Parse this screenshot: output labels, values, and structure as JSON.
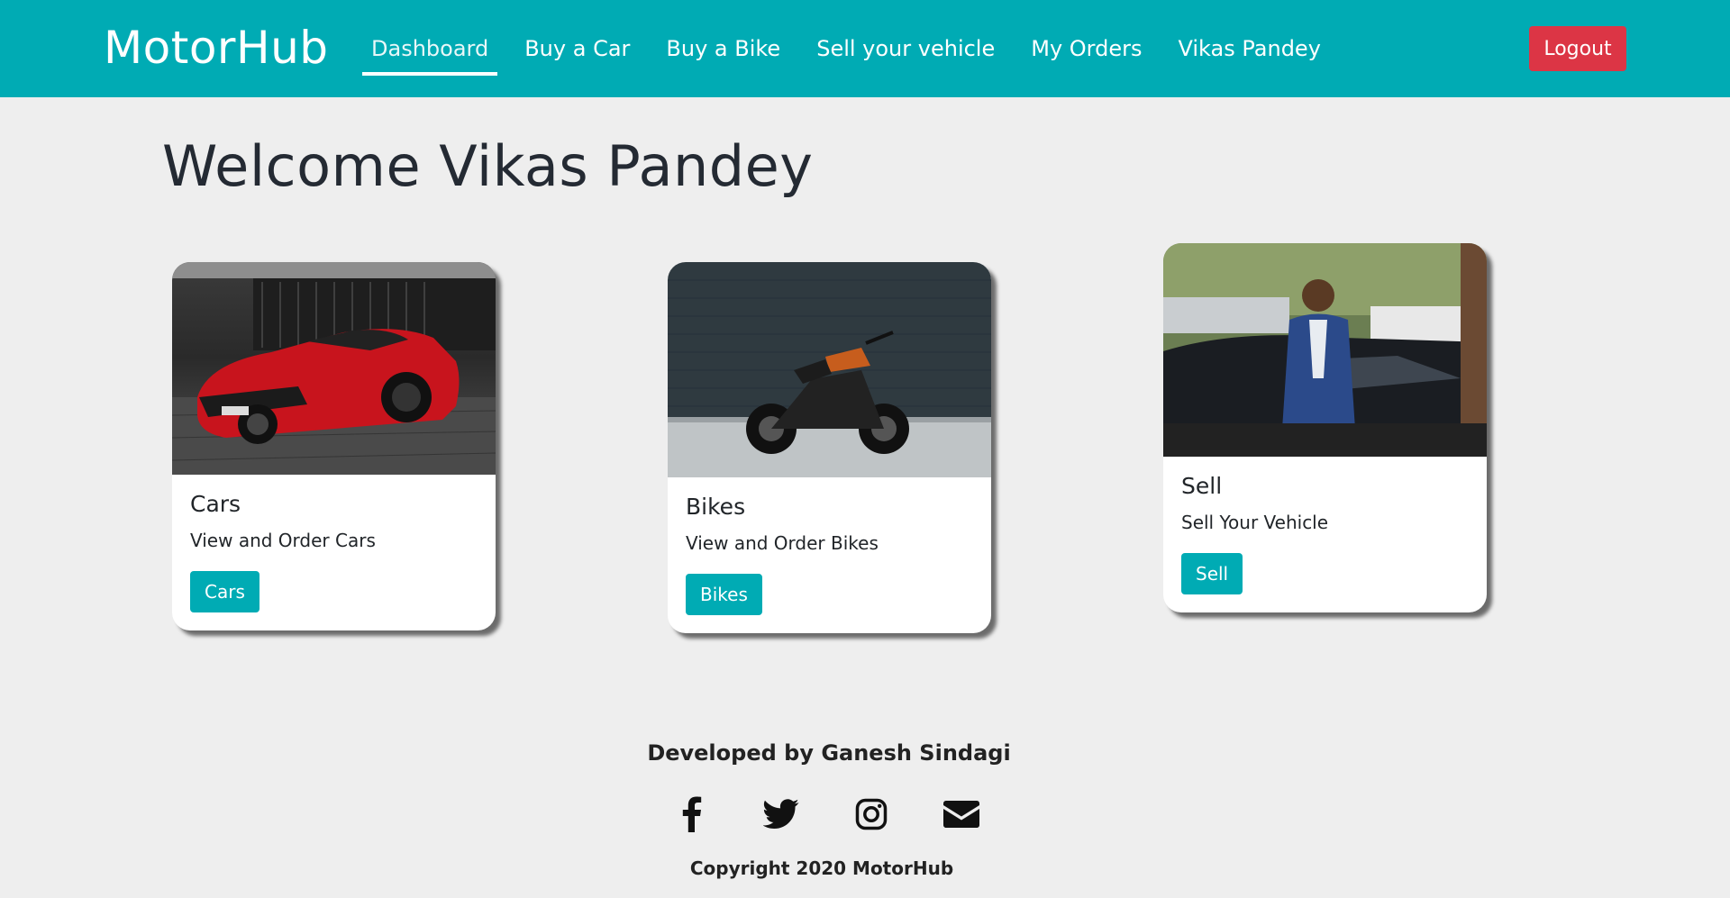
{
  "nav": {
    "brand": "MotorHub",
    "links": [
      {
        "label": "Dashboard",
        "active": true
      },
      {
        "label": "Buy a Car"
      },
      {
        "label": "Buy a Bike"
      },
      {
        "label": "Sell your vehicle"
      },
      {
        "label": "My Orders"
      },
      {
        "label": "Vikas Pandey"
      }
    ],
    "logout_label": "Logout"
  },
  "page": {
    "welcome": "Welcome Vikas Pandey"
  },
  "cards": [
    {
      "title": "Cars",
      "text": "View and Order Cars",
      "button": "Cars",
      "image": "red-sports-car-photo"
    },
    {
      "title": "Bikes",
      "text": "View and Order Bikes",
      "button": "Bikes",
      "image": "motorcycle-photo"
    },
    {
      "title": "Sell",
      "text": "Sell Your Vehicle",
      "button": "Sell",
      "image": "man-beside-car-photo"
    }
  ],
  "footer": {
    "developed_by": "Developed by Ganesh Sindagi",
    "social_icons": [
      "facebook-icon",
      "twitter-icon",
      "instagram-icon",
      "envelope-icon"
    ],
    "copyright": "Copyright 2020 MotorHub"
  },
  "colors": {
    "primary": "#00abb4",
    "danger": "#dc3545",
    "background": "#eeeeee"
  }
}
